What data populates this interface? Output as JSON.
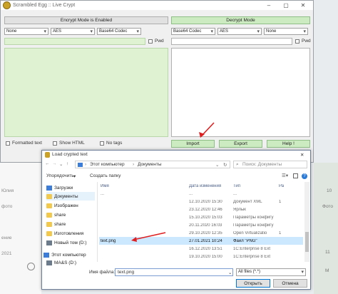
{
  "window": {
    "title": "Scrambled Egg :: Live Crypt",
    "min": "–",
    "max": "▢",
    "close": "✕"
  },
  "encrypt": {
    "header": "Encrypt Mode is Enabled",
    "pre": "None",
    "cipher": "AES",
    "post": "Base64 Codec",
    "pwd_label": "Pwd",
    "formatted_text": "Formatted text",
    "show_html": "Show HTML",
    "no_tags": "No tags"
  },
  "decrypt": {
    "header": "Decrypt Mode",
    "pre": "Base64 Codec",
    "cipher": "AES",
    "post": "None",
    "pwd_label": "Pwd",
    "import": "Import",
    "export": "Export",
    "help": "Help !"
  },
  "bg_left": [
    "Юлия",
    "фото",
    "ение",
    "2021"
  ],
  "bg_right": [
    "10",
    "Фото",
    "11",
    "M"
  ],
  "dialog": {
    "title": "Load crypted text",
    "close": "✕",
    "path": [
      "Этот компьютер",
      "Документы"
    ],
    "search_placeholder": "Поиск: Документы",
    "organize": "Упорядочить",
    "new_folder": "Создать папку",
    "nav": [
      {
        "label": "Загрузки",
        "icon": "download-icon"
      },
      {
        "label": "Документы",
        "icon": "folder-icon"
      },
      {
        "label": "Изображен",
        "icon": "folder-icon"
      },
      {
        "label": "share",
        "icon": "folder-icon"
      },
      {
        "label": "share",
        "icon": "folder-icon"
      },
      {
        "label": "Изготовления",
        "icon": "folder-icon"
      },
      {
        "label": "Новый том (D:)",
        "icon": "drive-icon"
      },
      {
        "label": "Этот компьютер",
        "icon": "computer-icon"
      },
      {
        "label": "MA&S (D:)",
        "icon": "drive-icon"
      }
    ],
    "columns": {
      "name": "Имя",
      "date": "Дата изменения",
      "type": "Тип",
      "size": "Ра"
    },
    "files": [
      {
        "name": "...",
        "date": "...",
        "type": "...",
        "size": ""
      },
      {
        "name": "",
        "date": "12.10.2020 15:30",
        "type": "Документ XML",
        "size": "1"
      },
      {
        "name": "",
        "date": "23.12.2020 12:46",
        "type": "Ярлык",
        "size": ""
      },
      {
        "name": "",
        "date": "15.10.2020 15:03",
        "type": "Параметры конфигу",
        "size": ""
      },
      {
        "name": "",
        "date": "20.11.2020 16:03",
        "type": "Параметры конфигу",
        "size": ""
      },
      {
        "name": "",
        "date": "29.10.2020 12:35",
        "type": "Open Virtualizatio",
        "size": "1"
      },
      {
        "name": "text.png",
        "date": "27.01.2021 10:24",
        "type": "Файл \"PNG\"",
        "size": ""
      },
      {
        "name": "",
        "date": "16.12.2020 13:51",
        "type": "1C:Enterprise 8 Ext",
        "size": ""
      },
      {
        "name": "",
        "date": "19.10.2020 15:00",
        "type": "1C:Enterprise 8 Ext",
        "size": ""
      }
    ],
    "filename_label": "Имя файла:",
    "filename_value": "text.png",
    "filter": "All files (*.*)",
    "open": "Открыть",
    "cancel": "Отмена"
  },
  "colors": {
    "accent_green": "#ccebc0",
    "selection": "#cce8ff",
    "annotation": "#e02020"
  }
}
